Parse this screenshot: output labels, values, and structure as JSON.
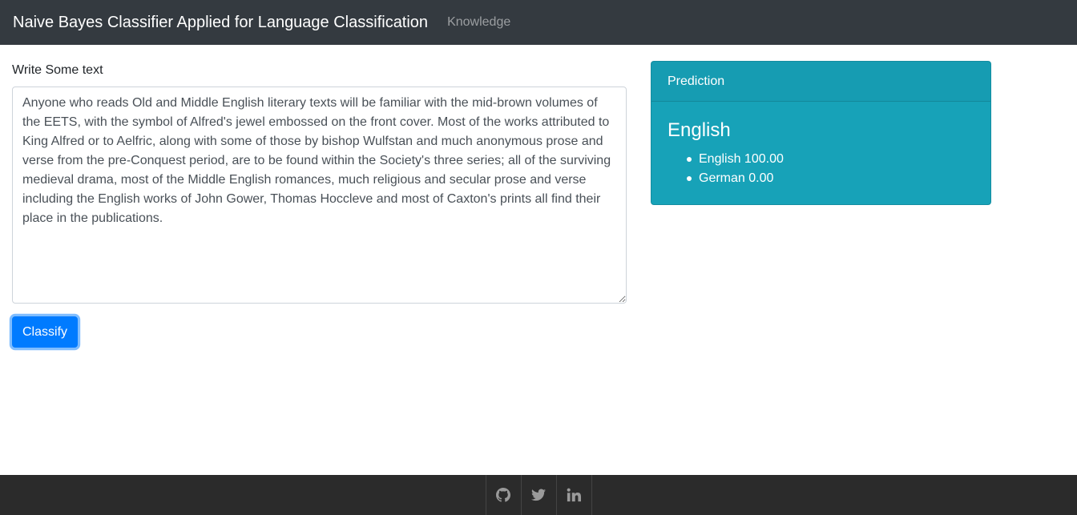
{
  "navbar": {
    "brand": "Naive Bayes Classifier Applied for Language Classification",
    "links": [
      {
        "label": "Knowledge"
      }
    ]
  },
  "form": {
    "label": "Write Some text",
    "text_value": "Anyone who reads Old and Middle English literary texts will be familiar with the mid-brown volumes of the EETS, with the symbol of Alfred's jewel embossed on the front cover. Most of the works attributed to King Alfred or to Aelfric, along with some of those by bishop Wulfstan and much anonymous prose and verse from the pre-Conquest period, are to be found within the Society's three series; all of the surviving medieval drama, most of the Middle English romances, much religious and secular prose and verse including the English works of John Gower, Thomas Hoccleve and most of Caxton's prints all find their place in the publications.",
    "classify_label": "Classify"
  },
  "prediction": {
    "header": "Prediction",
    "language": "English",
    "scores": [
      {
        "text": "English 100.00"
      },
      {
        "text": "German 0.00"
      }
    ]
  },
  "footer": {
    "icons": [
      "github-icon",
      "twitter-icon",
      "linkedin-icon"
    ]
  },
  "colors": {
    "navbar_bg": "#343a40",
    "card_bg": "#17a2b8",
    "button_bg": "#007bff",
    "footer_bg": "#2b2b2b"
  }
}
